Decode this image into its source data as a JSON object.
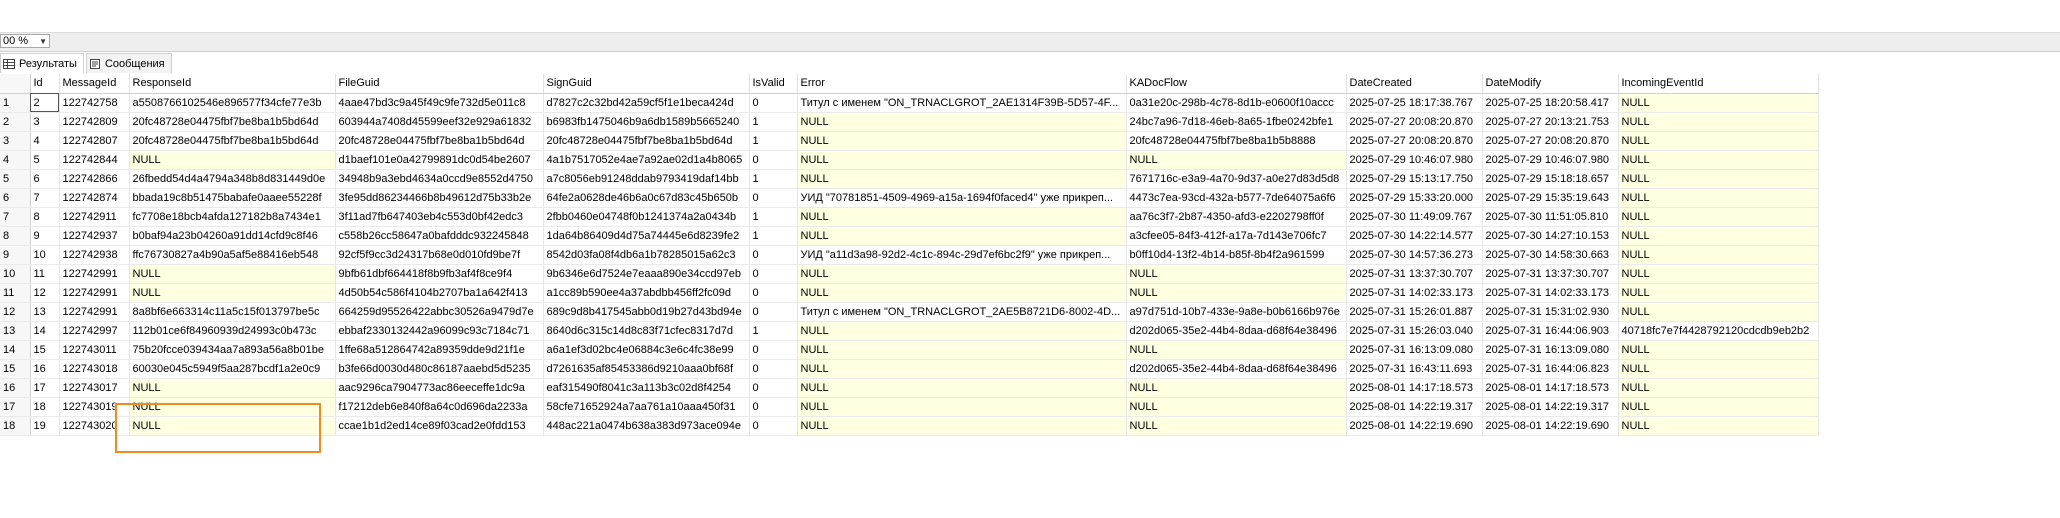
{
  "toolbar": {
    "zoom_value": "00 %"
  },
  "tabs": [
    {
      "label": "Результаты",
      "active": true,
      "icon": "grid-results-icon"
    },
    {
      "label": "Сообщения",
      "active": false,
      "icon": "messages-icon"
    }
  ],
  "columns": [
    "",
    "Id",
    "MessageId",
    "ResponseId",
    "FileGuid",
    "SignGuid",
    "IsValid",
    "Error",
    "KADocFlow",
    "DateCreated",
    "DateModify",
    "IncomingEventId"
  ],
  "rows": [
    [
      "1",
      "2",
      "122742758",
      "a5508766102546e896577f34cfe77e3b",
      "4aae47bd3c9a45f49c9fe732d5e011c8",
      "d7827c2c32bd42a59cf5f1e1beca424d",
      "0",
      "Титул с именем \"ON_TRNACLGROT_2AE1314F39B-5D57-4F...",
      "0a31e20c-298b-4c78-8d1b-e0600f10accc",
      "2025-07-25 18:17:38.767",
      "2025-07-25 18:20:58.417",
      "NULL"
    ],
    [
      "2",
      "3",
      "122742809",
      "20fc48728e04475fbf7be8ba1b5bd64d",
      "603944a7408d45599eef32e929a61832",
      "b6983fb1475046b9a6db1589b5665240",
      "1",
      "NULL",
      "24bc7a96-7d18-46eb-8a65-1fbe0242bfe1",
      "2025-07-27 20:08:20.870",
      "2025-07-27 20:13:21.753",
      "NULL"
    ],
    [
      "3",
      "4",
      "122742807",
      "20fc48728e04475fbf7be8ba1b5bd64d",
      "20fc48728e04475fbf7be8ba1b5bd64d",
      "20fc48728e04475fbf7be8ba1b5bd64d",
      "1",
      "NULL",
      "20fc48728e04475fbf7be8ba1b5b8888",
      "2025-07-27 20:08:20.870",
      "2025-07-27 20:08:20.870",
      "NULL"
    ],
    [
      "4",
      "5",
      "122742844",
      "NULL",
      "d1baef101e0a42799891dc0d54be2607",
      "4a1b7517052e4ae7a92ae02d1a4b8065",
      "0",
      "NULL",
      "NULL",
      "2025-07-29 10:46:07.980",
      "2025-07-29 10:46:07.980",
      "NULL"
    ],
    [
      "5",
      "6",
      "122742866",
      "26fbedd54d4a4794a348b8d831449d0e",
      "34948b9a3ebd4634a0ccd9e8552d4750",
      "a7c8056eb91248ddab9793419daf14bb",
      "1",
      "NULL",
      "7671716c-e3a9-4a70-9d37-a0e27d83d5d8",
      "2025-07-29 15:13:17.750",
      "2025-07-29 15:18:18.657",
      "NULL"
    ],
    [
      "6",
      "7",
      "122742874",
      "bbada19c8b51475babafe0aaee55228f",
      "3fe95dd86234466b8b49612d75b33b2e",
      "64fe2a0628de46b6a0c67d83c45b650b",
      "0",
      "УИД \"70781851-4509-4969-a15a-1694f0faced4\" уже прикреп...",
      "4473c7ea-93cd-432a-b577-7de64075a6f6",
      "2025-07-29 15:33:20.000",
      "2025-07-29 15:35:19.643",
      "NULL"
    ],
    [
      "7",
      "8",
      "122742911",
      "fc7708e18bcb4afda127182b8a7434e1",
      "3f11ad7fb647403eb4c553d0bf42edc3",
      "2fbb0460e04748f0b1241374a2a0434b",
      "1",
      "NULL",
      "aa76c3f7-2b87-4350-afd3-e2202798ff0f",
      "2025-07-30 11:49:09.767",
      "2025-07-30 11:51:05.810",
      "NULL"
    ],
    [
      "8",
      "9",
      "122742937",
      "b0baf94a23b04260a91dd14cfd9c8f46",
      "c558b26cc58647a0bafdddc932245848",
      "1da64b86409d4d75a74445e6d8239fe2",
      "1",
      "NULL",
      "a3cfee05-84f3-412f-a17a-7d143e706fc7",
      "2025-07-30 14:22:14.577",
      "2025-07-30 14:27:10.153",
      "NULL"
    ],
    [
      "9",
      "10",
      "122742938",
      "ffc76730827a4b90a5af5e88416eb548",
      "92cf5f9cc3d24317b68e0d010fd9be7f",
      "8542d03fa08f4db6a1b78285015a62c3",
      "0",
      "УИД \"a11d3a98-92d2-4c1c-894c-29d7ef6bc2f9\" уже прикреп...",
      "b0ff10d4-13f2-4b14-b85f-8b4f2a961599",
      "2025-07-30 14:57:36.273",
      "2025-07-30 14:58:30.663",
      "NULL"
    ],
    [
      "10",
      "11",
      "122742991",
      "NULL",
      "9bfb61dbf664418f8b9fb3af4f8ce9f4",
      "9b6346e6d7524e7eaaa890e34ccd97eb",
      "0",
      "NULL",
      "NULL",
      "2025-07-31 13:37:30.707",
      "2025-07-31 13:37:30.707",
      "NULL"
    ],
    [
      "11",
      "12",
      "122742991",
      "NULL",
      "4d50b54c586f4104b2707ba1a642f413",
      "a1cc89b590ee4a37abdbb456ff2fc09d",
      "0",
      "NULL",
      "NULL",
      "2025-07-31 14:02:33.173",
      "2025-07-31 14:02:33.173",
      "NULL"
    ],
    [
      "12",
      "13",
      "122742991",
      "8a8bf6e663314c11a5c15f013797be5c",
      "664259d95526422abbc30526a9479d7e",
      "689c9d8b417545abb0d19b27d43bd94e",
      "0",
      "Титул с именем \"ON_TRNACLGROT_2AE5B8721D6-8002-4D...",
      "a97d751d-10b7-433e-9a8e-b0b6166b976e",
      "2025-07-31 15:26:01.887",
      "2025-07-31 15:31:02.930",
      "NULL"
    ],
    [
      "13",
      "14",
      "122742997",
      "112b01ce6f84960939d24993c0b473c",
      "ebbaf2330132442a96099c93c7184c71",
      "8640d6c315c14d8c83f71cfec8317d7d",
      "1",
      "NULL",
      "d202d065-35e2-44b4-8daa-d68f64e38496",
      "2025-07-31 15:26:03.040",
      "2025-07-31 16:44:06.903",
      "40718fc7e7f4428792120cdcdb9eb2b2"
    ],
    [
      "14",
      "15",
      "122743011",
      "75b20fcce039434aa7a893a56a8b01be",
      "1ffe68a512864742a89359dde9d21f1e",
      "a6a1ef3d02bc4e06884c3e6c4fc38e99",
      "0",
      "NULL",
      "NULL",
      "2025-07-31 16:13:09.080",
      "2025-07-31 16:13:09.080",
      "NULL"
    ],
    [
      "15",
      "16",
      "122743018",
      "60030e045c5949f5aa287bcdf1a2e0c9",
      "b3fe66d0030d480c86187aaebd5d5235",
      "d7261635af85453386d9210aaa0bf68f",
      "0",
      "NULL",
      "d202d065-35e2-44b4-8daa-d68f64e38496",
      "2025-07-31 16:43:11.693",
      "2025-07-31 16:44:06.823",
      "NULL"
    ],
    [
      "16",
      "17",
      "122743017",
      "NULL",
      "aac9296ca7904773ac86eeceffe1dc9a",
      "eaf315490f8041c3a113b3c02d8f4254",
      "0",
      "NULL",
      "NULL",
      "2025-08-01 14:17:18.573",
      "2025-08-01 14:17:18.573",
      "NULL"
    ],
    [
      "17",
      "18",
      "122743019",
      "NULL",
      "f17212deb6e840f8a64c0d696da2233a",
      "58cfe71652924a7aa761a10aaa450f31",
      "0",
      "NULL",
      "NULL",
      "2025-08-01 14:22:19.317",
      "2025-08-01 14:22:19.317",
      "NULL"
    ],
    [
      "18",
      "19",
      "122743020",
      "NULL",
      "ccae1b1d2ed14ce89f03cad2e0fdd153",
      "448ac221a0474b638a383d973ace094e",
      "0",
      "NULL",
      "NULL",
      "2025-08-01 14:22:19.690",
      "2025-08-01 14:22:19.690",
      "NULL"
    ]
  ],
  "selected_cell": {
    "row": 0,
    "col": 1
  }
}
